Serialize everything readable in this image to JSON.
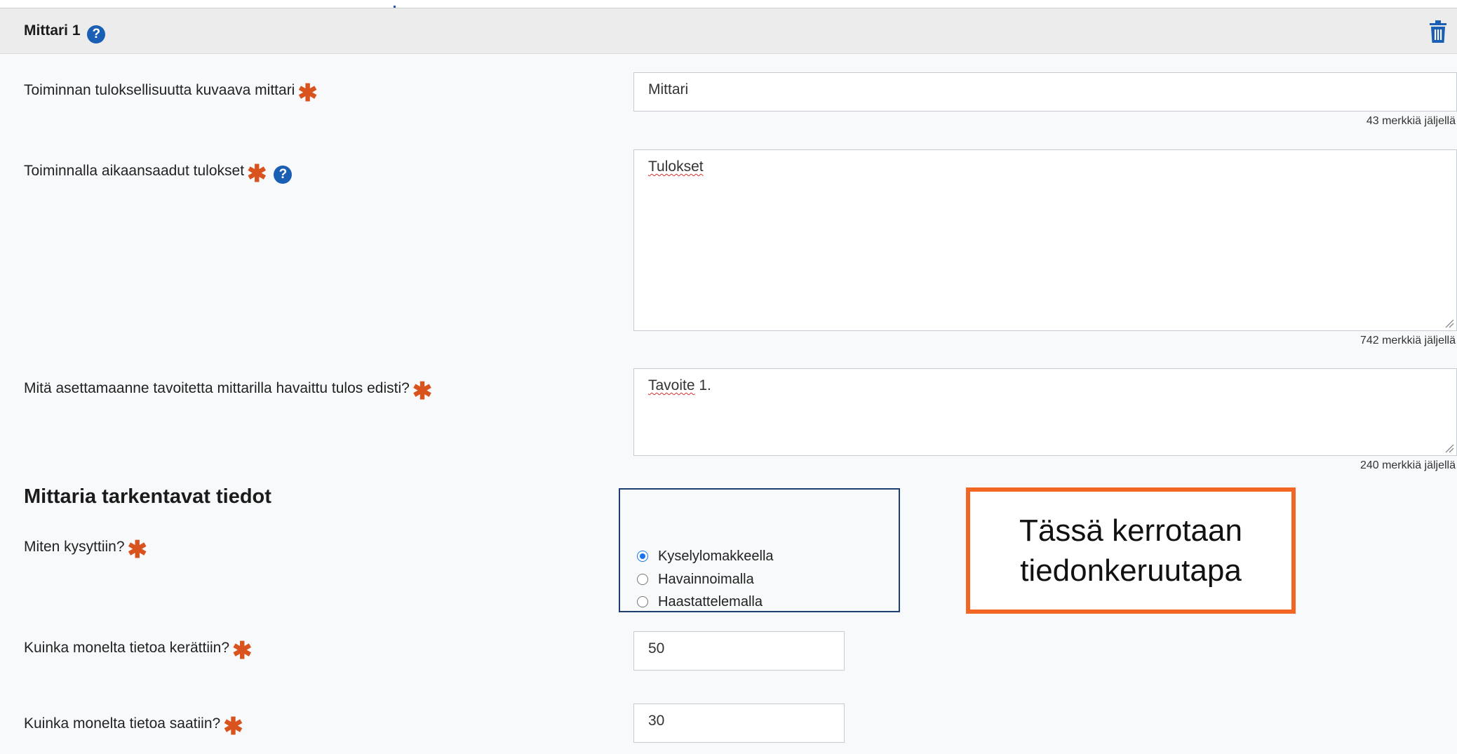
{
  "panel": {
    "title": "Mittari 1",
    "help_glyph": "?",
    "delete_icon": "trash-icon"
  },
  "fields": {
    "metric": {
      "label": "Toiminnan tuloksellisuutta kuvaava mittari",
      "value": "Mittari",
      "counter": "43 merkkiä jäljellä"
    },
    "results": {
      "label": "Toiminnalla aikaansaadut tulokset",
      "value": "Tulokset",
      "counter": "742 merkkiä jäljellä"
    },
    "goal": {
      "label": "Mitä asettamaanne tavoitetta mittarilla havaittu tulos edisti?",
      "value_word": "Tavoite",
      "value_rest": " 1.",
      "counter": "240 merkkiä jäljellä"
    }
  },
  "section": {
    "title": "Mittaria tarkentavat tiedot"
  },
  "method": {
    "label": "Miten kysyttiin?",
    "options": [
      "Kyselylomakkeella",
      "Havainnoimalla",
      "Haastattelemalla"
    ],
    "selected": "Kyselylomakkeella"
  },
  "collected": {
    "label": "Kuinka monelta tietoa kerättiin?",
    "value": "50"
  },
  "received": {
    "label": "Kuinka monelta tietoa saatiin?",
    "value": "30"
  },
  "callout": {
    "line1": "Tässä kerrotaan",
    "line2": "tiedonkeruutapa"
  },
  "required_marker": "✱",
  "colors": {
    "required": "#d9531e",
    "help_icon": "#1a5fb4",
    "callout_border": "#f26522",
    "radio_box_border": "#1f3f73"
  }
}
